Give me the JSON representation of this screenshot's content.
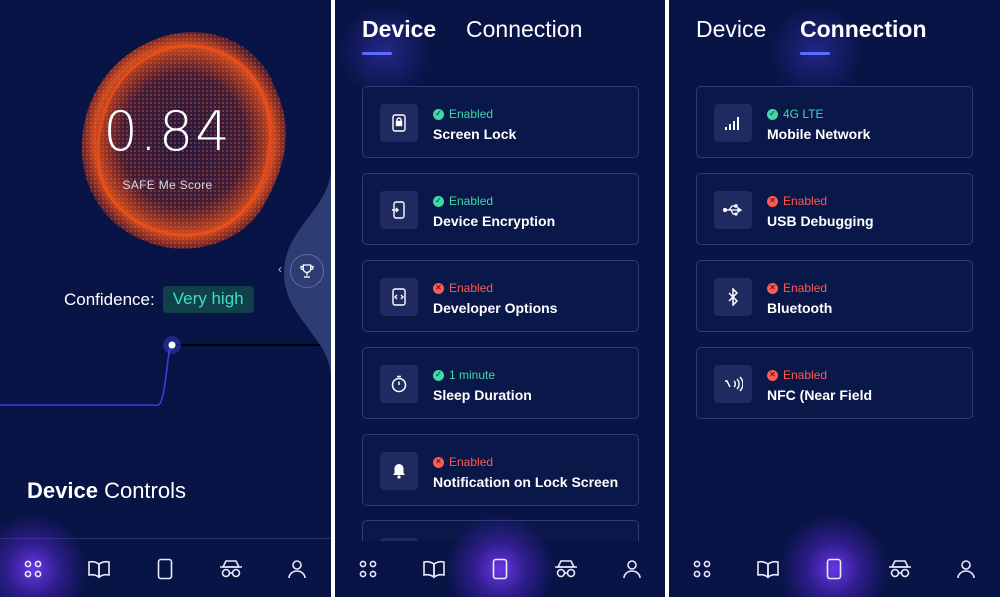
{
  "score_screen": {
    "score": "0.84",
    "score_label": "SAFE Me Score",
    "confidence_label": "Confidence:",
    "confidence_value": "Very high",
    "section_title_bold": "Device",
    "section_title_rest": " Controls"
  },
  "device_screen": {
    "tabs": [
      "Device",
      "Connection"
    ],
    "active_tab": "Device",
    "items": [
      {
        "status": "Enabled",
        "state": "ok",
        "title": "Screen Lock",
        "icon": "phone-lock-icon"
      },
      {
        "status": "Enabled",
        "state": "ok",
        "title": "Device Encryption",
        "icon": "phone-encryption-icon"
      },
      {
        "status": "Enabled",
        "state": "bad",
        "title": "Developer Options",
        "icon": "developer-options-icon"
      },
      {
        "status": "1 minute",
        "state": "ok",
        "title": "Sleep Duration",
        "icon": "timer-icon"
      },
      {
        "status": "Enabled",
        "state": "bad",
        "title": "Notification on Lock Screen",
        "icon": "bell-icon"
      }
    ]
  },
  "connection_screen": {
    "tabs": [
      "Device",
      "Connection"
    ],
    "active_tab": "Connection",
    "items": [
      {
        "status": "4G LTE",
        "state": "ok",
        "title": "Mobile Network",
        "icon": "signal-icon"
      },
      {
        "status": "Enabled",
        "state": "bad",
        "title": "USB Debugging",
        "icon": "usb-icon"
      },
      {
        "status": "Enabled",
        "state": "bad",
        "title": "Bluetooth",
        "icon": "bluetooth-icon"
      },
      {
        "status": "Enabled",
        "state": "bad",
        "title": "NFC (Near Field",
        "icon": "nfc-icon"
      }
    ]
  },
  "nav": {
    "items": [
      "dashboard-icon",
      "book-icon",
      "phone-icon",
      "spy-icon",
      "profile-icon"
    ],
    "active_index_screen1": 0,
    "active_index_screen2": 2,
    "active_index_screen3": 2
  },
  "colors": {
    "background": "#081446",
    "accent": "#5a6cff",
    "ok": "#3fd9a7",
    "bad": "#ff5a4e",
    "blob": "#ff4a12"
  }
}
